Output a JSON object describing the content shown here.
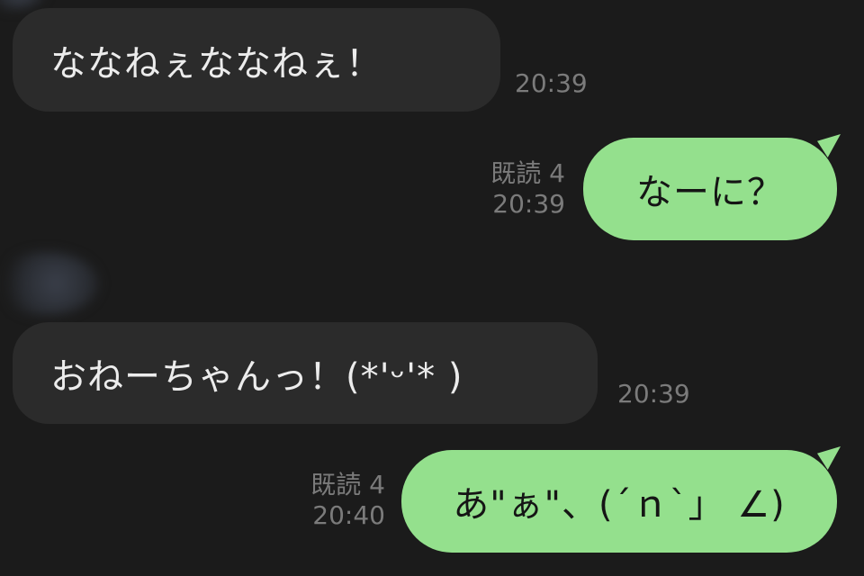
{
  "messages": [
    {
      "direction": "incoming",
      "text": "ななねぇななねぇ！",
      "time": "20:39"
    },
    {
      "direction": "outgoing",
      "text": "なーに？",
      "read": "既読 4",
      "time": "20:39"
    },
    {
      "direction": "incoming",
      "text": "おねーちゃんっ！(*'ᵕ'* )",
      "time": "20:39"
    },
    {
      "direction": "outgoing",
      "text": "あ\"ぁ\"、(´ｎ`」 ∠)",
      "read": "既読 4",
      "time": "20:40"
    }
  ],
  "colors": {
    "background": "#1b1b1b",
    "incoming_bubble": "#2b2b2b",
    "outgoing_bubble": "#94e08d",
    "meta_text": "#7b7b7b"
  },
  "icons": [
    "avatar-icon"
  ]
}
